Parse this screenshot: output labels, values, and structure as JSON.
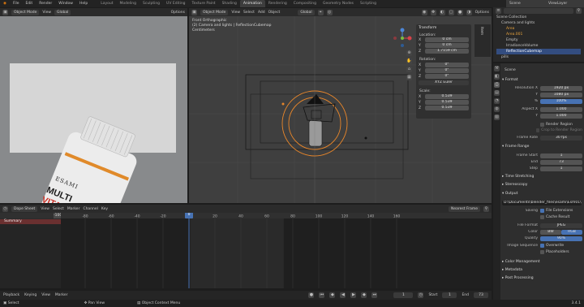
{
  "menu": {
    "items": [
      "File",
      "Edit",
      "Render",
      "Window",
      "Help"
    ],
    "workspaces": [
      "Layout",
      "Modeling",
      "Sculpting",
      "UV Editing",
      "Texture Paint",
      "Shading",
      "Animation",
      "Rendering",
      "Compositing",
      "Geometry Nodes",
      "Scripting"
    ],
    "active_workspace": "Animation",
    "scene": "Scene",
    "view_layer": "ViewLayer"
  },
  "left_header": {
    "mode": "Object Mode",
    "view": "View",
    "global": "Global",
    "options": "Options"
  },
  "center_header": {
    "mode": "Object Mode",
    "items": [
      "View",
      "Select",
      "Add",
      "Object"
    ],
    "global": "Global",
    "options": "Options"
  },
  "viewport": {
    "title": "Front Orthographic",
    "collection": "(2) Camera and lights | ReflectionCubemap",
    "units": "Centimeters"
  },
  "product": {
    "brand": "ESAMI",
    "line1": "MULTI",
    "line2": "VITAMIN"
  },
  "transform": {
    "title": "Transform",
    "location_label": "Location:",
    "location": [
      [
        "X",
        "0 cm"
      ],
      [
        "Y",
        "0 cm"
      ],
      [
        "Z",
        "1.7159 cm"
      ]
    ],
    "rotation_label": "Rotation:",
    "rotation": [
      [
        "X",
        "0°"
      ],
      [
        "Y",
        "0°"
      ],
      [
        "Z",
        "0°"
      ]
    ],
    "rotation_mode": "XYZ Euler",
    "scale_label": "Scale:",
    "scale": [
      [
        "X",
        "0.539"
      ],
      [
        "Y",
        "0.539"
      ],
      [
        "Z",
        "0.539"
      ]
    ]
  },
  "outliner": {
    "items": [
      "Scene Collection",
      "Camera and lights",
      "Area",
      "Area.001",
      "Empty",
      "IrradianceVolume",
      "ReflectionCubemap",
      "pills"
    ]
  },
  "properties": {
    "scene_label": "Scene",
    "format": {
      "title": "Format",
      "resolution_x_label": "Resolution X",
      "resolution_x": "1920 px",
      "y_label": "Y",
      "resolution_y": "1080 px",
      "percent": "100%",
      "aspect_x_label": "Aspect X",
      "aspect_x": "1.000",
      "aspect_y": "1.000",
      "render_region": "Render Region",
      "crop": "Crop to Render Region",
      "frame_rate_label": "Frame Rate",
      "frame_rate": "30 fps"
    },
    "frame_range": {
      "title": "Frame Range",
      "start_label": "Frame Start",
      "start": "1",
      "end_label": "End",
      "end": "73",
      "step_label": "Step",
      "step": "1"
    },
    "time_stretching": "Time Stretching",
    "stereoscopy": "Stereoscopy",
    "output": {
      "title": "Output",
      "path": "D:\\Documents\\blender_files\\esami\\Esm01\\",
      "saving_label": "Saving",
      "file_extensions": "File Extensions",
      "cache_result": "Cache Result",
      "file_format_label": "File Format",
      "file_format": "JPEG",
      "color_label": "Color",
      "bw": "BW",
      "rgb": "RGB",
      "quality_label": "Quality",
      "quality": "90%",
      "image_sequence_label": "Image Sequence",
      "overwrite": "Overwrite",
      "placeholders": "Placeholders"
    },
    "color_management": "Color Management",
    "metadata": "Metadata",
    "post_processing": "Post Processing"
  },
  "timeline": {
    "mode": "Dope Sheet",
    "menu": [
      "View",
      "Select",
      "Marker",
      "Channel",
      "Key"
    ],
    "nearest_frame": "Nearest Frame",
    "summary": "Summary",
    "current_frame": "0",
    "ticks": [
      "-80",
      "-60",
      "-40",
      "-20",
      "0",
      "20",
      "40",
      "60",
      "80",
      "100",
      "120",
      "140",
      "160"
    ],
    "tick_values": [
      -80,
      -60,
      -40,
      -20,
      0,
      20,
      40,
      60,
      80,
      100,
      120,
      140,
      160
    ],
    "left_frame": "-100"
  },
  "playback": {
    "items": [
      "Playback",
      "Keying",
      "View",
      "Marker"
    ],
    "frame": "1",
    "start_label": "Start",
    "start": "1",
    "end_label": "End",
    "end": "73"
  },
  "status": {
    "select": "Select",
    "pan": "Pan View",
    "context": "Object Context Menu",
    "version": "3.4.1"
  }
}
